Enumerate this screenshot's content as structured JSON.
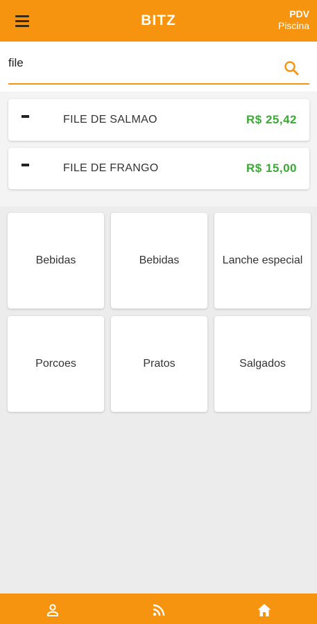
{
  "header": {
    "title": "BITZ",
    "pdv_label": "PDV",
    "pdv_location": "Piscina"
  },
  "search": {
    "value": "file",
    "placeholder": ""
  },
  "results": [
    {
      "name": "FILE DE SALMAO",
      "price": "R$ 25,42"
    },
    {
      "name": "FILE DE FRANGO",
      "price": "R$ 15,00"
    }
  ],
  "categories": [
    {
      "label": "Bebidas"
    },
    {
      "label": "Bebidas"
    },
    {
      "label": "Lanche especial"
    },
    {
      "label": "Porcoes"
    },
    {
      "label": "Pratos"
    },
    {
      "label": "Salgados"
    }
  ],
  "colors": {
    "accent": "#f7940f",
    "price": "#3aaa35"
  },
  "bottom_nav": {
    "items": [
      "person-icon",
      "rss-icon",
      "home-icon"
    ]
  }
}
